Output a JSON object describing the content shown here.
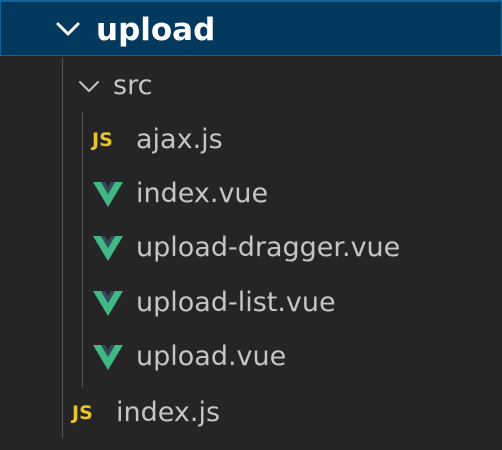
{
  "explorer": {
    "root": {
      "label": "upload",
      "icon": "chevron-down-icon"
    },
    "folder": {
      "label": "src",
      "icon": "chevron-down-icon"
    },
    "files": [
      {
        "label": "ajax.js",
        "icon_text": "JS",
        "icon": "javascript-file-icon"
      },
      {
        "label": "index.vue",
        "icon": "vue-file-icon"
      },
      {
        "label": "upload-dragger.vue",
        "icon": "vue-file-icon"
      },
      {
        "label": "upload-list.vue",
        "icon": "vue-file-icon"
      },
      {
        "label": "upload.vue",
        "icon": "vue-file-icon"
      }
    ],
    "root_files": [
      {
        "label": "index.js",
        "icon_text": "JS",
        "icon": "javascript-file-icon"
      }
    ]
  },
  "colors": {
    "background": "#252526",
    "selected_row": "#04395e",
    "selected_border": "#0e639c",
    "js_yellow": "#e8c62a",
    "vue_green": "#41b883",
    "vue_dark": "#34495e",
    "text": "#c5c5c5"
  }
}
